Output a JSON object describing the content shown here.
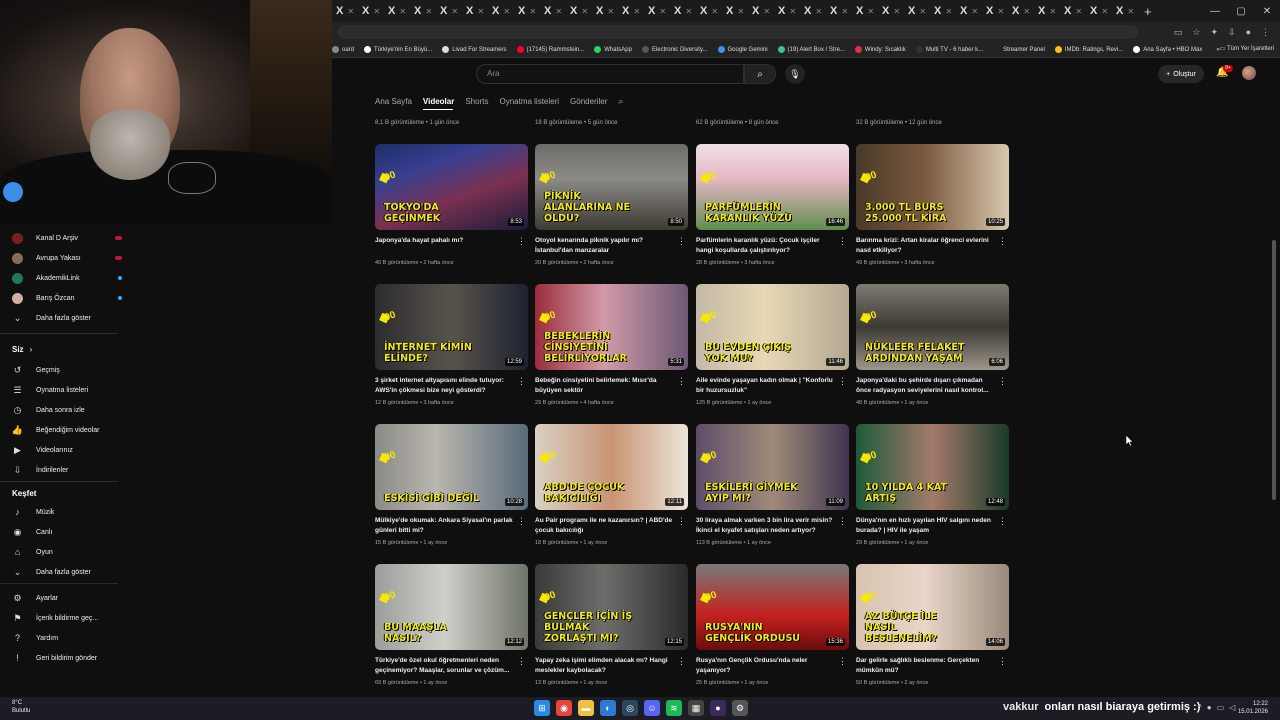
{
  "browser": {
    "tab_glyph": "X",
    "tab_count": 31,
    "bookmarks": [
      {
        "label": "oard",
        "color": "#888888"
      },
      {
        "label": "Türkiye'nin En Büyü...",
        "color": "#ffffff"
      },
      {
        "label": "Livad For Streamers",
        "color": "#dddddd"
      },
      {
        "label": "(17145) Rammstein...",
        "color": "#ff0033"
      },
      {
        "label": "WhatsApp",
        "color": "#25d366"
      },
      {
        "label": "Electronic Diversity...",
        "color": "#555555"
      },
      {
        "label": "Google Gemini",
        "color": "#4a8cf0"
      },
      {
        "label": "(19) Alert Box / Stre...",
        "color": "#31c3a2"
      },
      {
        "label": "Windy: Sıcaklık",
        "color": "#e0304b"
      },
      {
        "label": "Multi TV - 6 haber k...",
        "color": "#333333"
      },
      {
        "label": "Streamer Panel",
        "color": "#222222"
      },
      {
        "label": "IMDb: Ratings, Revi...",
        "color": "#f5c518"
      },
      {
        "label": "Ana Sayfa • HBO Max",
        "color": "#ffffff"
      }
    ],
    "bookmarks_more": "»",
    "all_bookmarks": "Tüm Yer İşaretleri"
  },
  "leftnav": {
    "subs": [
      {
        "label": "Kanal D Arşiv",
        "live": "red"
      },
      {
        "label": "Avrupa Yakası",
        "live": "red"
      },
      {
        "label": "AkademikLink",
        "live": "dot"
      },
      {
        "label": "Barış Özcan",
        "live": "dot"
      }
    ],
    "show_more": "Daha fazla göster",
    "you_heading": "Siz",
    "you_items": [
      {
        "label": "Geçmiş",
        "icon": "history-icon"
      },
      {
        "label": "Oynatma listeleri",
        "icon": "playlist-icon"
      },
      {
        "label": "Daha sonra izle",
        "icon": "clock-icon"
      },
      {
        "label": "Beğendiğim videolar",
        "icon": "like-icon"
      },
      {
        "label": "Videolarınız",
        "icon": "video-icon"
      },
      {
        "label": "İndirilenler",
        "icon": "download-icon"
      }
    ],
    "explore_heading": "Keşfet",
    "explore_items": [
      {
        "label": "Müzik",
        "icon": "music-icon"
      },
      {
        "label": "Canlı",
        "icon": "live-icon"
      },
      {
        "label": "Oyun",
        "icon": "gaming-icon"
      },
      {
        "label": "Daha fazla göster",
        "icon": "chevron-down-icon"
      }
    ],
    "settings_items": [
      {
        "label": "Ayarlar",
        "icon": "gear-icon"
      },
      {
        "label": "İçerik bildirme geç...",
        "icon": "flag-icon"
      },
      {
        "label": "Yardım",
        "icon": "help-icon"
      },
      {
        "label": "Geri bildirim gönder",
        "icon": "feedback-icon"
      }
    ]
  },
  "topbar": {
    "search_placeholder": "Ara",
    "create_label": "Oluştur",
    "notif_count": "9+"
  },
  "channel_tabs": [
    "Ana Sayfa",
    "Videolar",
    "Shorts",
    "Oynatma listeleri",
    "Gönderiler"
  ],
  "active_tab": "Videolar",
  "prev_row_meta": [
    "8,1 B görüntüleme • 1 gün önce",
    "18 B görüntüleme • 5 gün önce",
    "62 B görüntüleme • 8 gün önce",
    "32 B görüntüleme • 12 gün önce"
  ],
  "videos": [
    {
      "thumb_text": "TOKYO'DA GEÇİNMEK",
      "duration": "8:53",
      "title": "Japonya'da hayat pahalı mı?",
      "meta": "40 B görüntüleme • 2 hafta önce",
      "bg": "linear-gradient(160deg,#1b2f6a 0%,#3a3f8f 30%,#7a3050 60%,#1a1d3a 100%)"
    },
    {
      "thumb_text": "PİKNİK ALANLARINA NE OLDU?",
      "duration": "8:50",
      "title": "Otoyol kenarında piknik yapılır mı? İstanbul'dan manzaralar",
      "meta": "20 B görüntüleme • 2 hafta önce",
      "bg": "linear-gradient(180deg,#6b6b68 0%,#8d8b86 40%,#3d3a33 100%)"
    },
    {
      "thumb_text": "PARFÜMLERİN KARANLIK YÜZÜ",
      "duration": "16:46",
      "title": "Parfümlerin karanlık yüzü: Çocuk işçiler hangi koşullarda çalıştırılıyor?",
      "meta": "28 B görüntüleme • 3 hafta önce",
      "bg": "linear-gradient(180deg,#f0e0e5 0%,#e7b7c5 40%,#5f8d4d 100%)"
    },
    {
      "thumb_text": "3.000 TL BURS 25.000 TL KİRA",
      "duration": "10:25",
      "title": "Barınma krizi: Artan kiralar öğrenci evlerini nasıl etkiliyor?",
      "meta": "49 B görüntüleme • 3 hafta önce",
      "bg": "linear-gradient(90deg,#4a3a2a 0%,#7a5a3e 45%,#d9c7ae 100%)"
    },
    {
      "thumb_text": "İNTERNET KİMİN ELİNDE?",
      "duration": "12:59",
      "title": "3 şirket internet altyapısını elinde tutuyor: AWS'in çökmesi bize neyi gösterdi?",
      "meta": "12 B görüntüleme • 3 hafta önce",
      "bg": "linear-gradient(90deg,#2c2c2e 0%,#58534c 50%,#1e2230 100%)"
    },
    {
      "thumb_text": "BEBEKLERİN CİNSİYETİNİ BELİRLİYORLAR",
      "duration": "5:31",
      "title": "Bebeğin cinsiyetini belirlemek: Mısır'da büyüyen sektör",
      "meta": "29 B görüntüleme • 4 hafta önce",
      "bg": "linear-gradient(90deg,#9a2d3d 0%,#d29aa8 45%,#6b5a73 100%)"
    },
    {
      "thumb_text": "BU EVDEN ÇIKIŞ YOK MU?",
      "duration": "11:46",
      "title": "Aile evinde yaşayan kadın olmak | \"Konforlu bir huzursuzluk\"",
      "meta": "125 B görüntüleme • 1 ay önce",
      "bg": "linear-gradient(90deg,#c4b8a7 0%,#e8d8b5 45%,#b4a892 100%)"
    },
    {
      "thumb_text": "NÜKLEER FELAKET ARDINDAN YAŞAM",
      "duration": "6:06",
      "title": "Japonya'daki bu şehirde dışarı çıkmadan önce radyasyon seviyelerini nasıl kontrol...",
      "meta": "48 B görüntüleme • 1 ay önce",
      "bg": "linear-gradient(180deg,#7f7b73 0%,#3c3833 50%,#9d968a 100%)"
    },
    {
      "thumb_text": "ESKİSİ GİBİ DEĞİL",
      "duration": "10:28",
      "title": "Mülkiye'de okumak: Ankara Siyasal'ın parlak günleri bitti mi?",
      "meta": "15 B görüntüleme • 1 ay önce",
      "bg": "linear-gradient(90deg,#8a8a86 0%,#b9b6ae 40%,#5a6a7a 100%)"
    },
    {
      "thumb_text": "ABD'DE ÇOCUK BAKICILIĞI",
      "duration": "12:11",
      "title": "Au Pair programı ile ne kazanırsın? | ABD'de çocuk bakıcılığı",
      "meta": "18 B görüntüleme • 1 ay önce",
      "bg": "linear-gradient(90deg,#d9d1c4 0%,#c89474 50%,#ece5d9 100%)"
    },
    {
      "thumb_text": "ESKİLERİ GİYMEK AYIP MI?",
      "duration": "11:09",
      "title": "30 liraya almak varken 3 bin lira verir misin? İkinci el kıyafet satışları neden artıyor?",
      "meta": "113 B görüntüleme • 1 ay önce",
      "bg": "linear-gradient(90deg,#5d4d6a 0%,#a08a79 50%,#3e3550 100%)"
    },
    {
      "thumb_text": "10 YILDA 4 KAT ARTIŞ",
      "duration": "12:48",
      "title": "Dünya'nın en hızlı yayılan HIV salgını neden burada? | HIV ile yaşam",
      "meta": "29 B görüntüleme • 1 ay önce",
      "bg": "linear-gradient(90deg,#1e5a3a 0%,#a37a6a 50%,#1a3a2a 100%)"
    },
    {
      "thumb_text": "BU MAAŞLA NASIL?",
      "duration": "12:12",
      "title": "Türkiye'de özel okul öğretmenleri neden geçinemiyor? Maaşlar, sorunlar ve çözüm...",
      "meta": "69 B görüntüleme • 1 ay önce",
      "bg": "linear-gradient(90deg,#9a9d9a 0%,#cfd0ca 45%,#6e7469 100%)"
    },
    {
      "thumb_text": "GENÇLER İÇİN İŞ BULMAK ZORLAŞTI MI?",
      "duration": "12:15",
      "title": "Yapay zeka işimi elimden alacak mı? Hangi meslekler kaybolacak?",
      "meta": "13 B görüntüleme • 1 ay önce",
      "bg": "linear-gradient(90deg,#3a3a3a 0%,#6d6d6a 45%,#2a2a2a 100%)"
    },
    {
      "thumb_text": "RUSYA'NIN GENÇLİK ORDUSU",
      "duration": "15:36",
      "title": "Rusya'nın Gençlik Ordusu'nda neler yaşanıyor?",
      "meta": "25 B görüntüleme • 1 ay önce",
      "bg": "linear-gradient(180deg,#7a7a7a 0%,#c42020 60%,#6a0d0d 100%)"
    },
    {
      "thumb_text": "AZ BÜTÇE İLE NASIL BESLENELİM?",
      "duration": "14:06",
      "title": "Dar gelirle sağlıklı beslenme: Gerçekten mümkün mü?",
      "meta": "50 B görüntüleme • 2 ay önce",
      "bg": "linear-gradient(90deg,#d8c2b0 0%,#e9d6c8 45%,#9a8a7a 100%)"
    }
  ],
  "taskbar": {
    "temperature": "8°C",
    "weather": "Bulutlu",
    "ticker_user": "vakkur",
    "ticker_text": "onları nasıl biaraya getirmiş :)",
    "time": "12:22",
    "date": "15.01.2026",
    "apps": [
      {
        "icon": "windows-icon",
        "color": "#2b89e6",
        "glyph": "⊞"
      },
      {
        "icon": "chrome-icon",
        "color": "#e8453c",
        "glyph": "◉"
      },
      {
        "icon": "folder-icon",
        "color": "#f0c040",
        "glyph": "▬"
      },
      {
        "icon": "edge-icon",
        "color": "#2a7ad6",
        "glyph": "◐"
      },
      {
        "icon": "steam-icon",
        "color": "#2a475e",
        "glyph": "◎"
      },
      {
        "icon": "discord-icon",
        "color": "#5865f2",
        "glyph": "☺"
      },
      {
        "icon": "spotify-icon",
        "color": "#1db954",
        "glyph": "≋"
      },
      {
        "icon": "calculator-icon",
        "color": "#444444",
        "glyph": "▦"
      },
      {
        "icon": "obs-icon",
        "color": "#3a2a5a",
        "glyph": "●"
      },
      {
        "icon": "settings-icon",
        "color": "#555555",
        "glyph": "⚙"
      }
    ]
  }
}
